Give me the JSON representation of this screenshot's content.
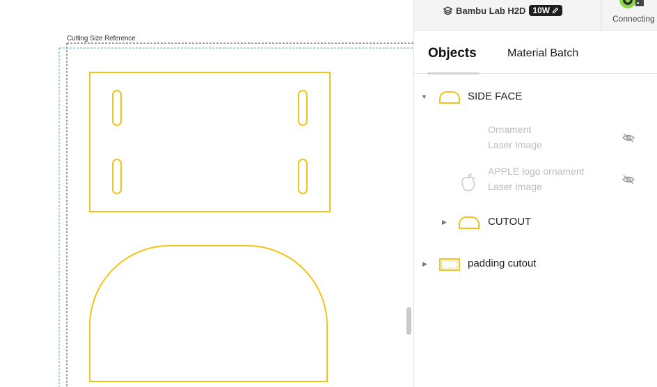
{
  "canvas": {
    "reference_label": "Cutting Size Reference"
  },
  "header": {
    "printer_name": "Bambu Lab H2D",
    "laser_power": "10W",
    "connection_status": "Connecting"
  },
  "tabs": {
    "objects": "Objects",
    "material_batch": "Material Batch"
  },
  "tree": {
    "side_face": {
      "label": "SIDE FACE"
    },
    "children": [
      {
        "name": "Ornament",
        "type": "Laser Image",
        "hidden_icon": "eye-slash-icon"
      },
      {
        "name": "APPLE logo ornament",
        "type": "Laser Image",
        "icon": "apple-icon",
        "hidden_icon": "eye-slash-icon"
      }
    ],
    "cutout": {
      "label": "CUTOUT"
    },
    "padding_cutout": {
      "label": "padding cutout"
    }
  },
  "colors": {
    "shape_stroke": "#f2c318",
    "accent": "#00ae42"
  }
}
